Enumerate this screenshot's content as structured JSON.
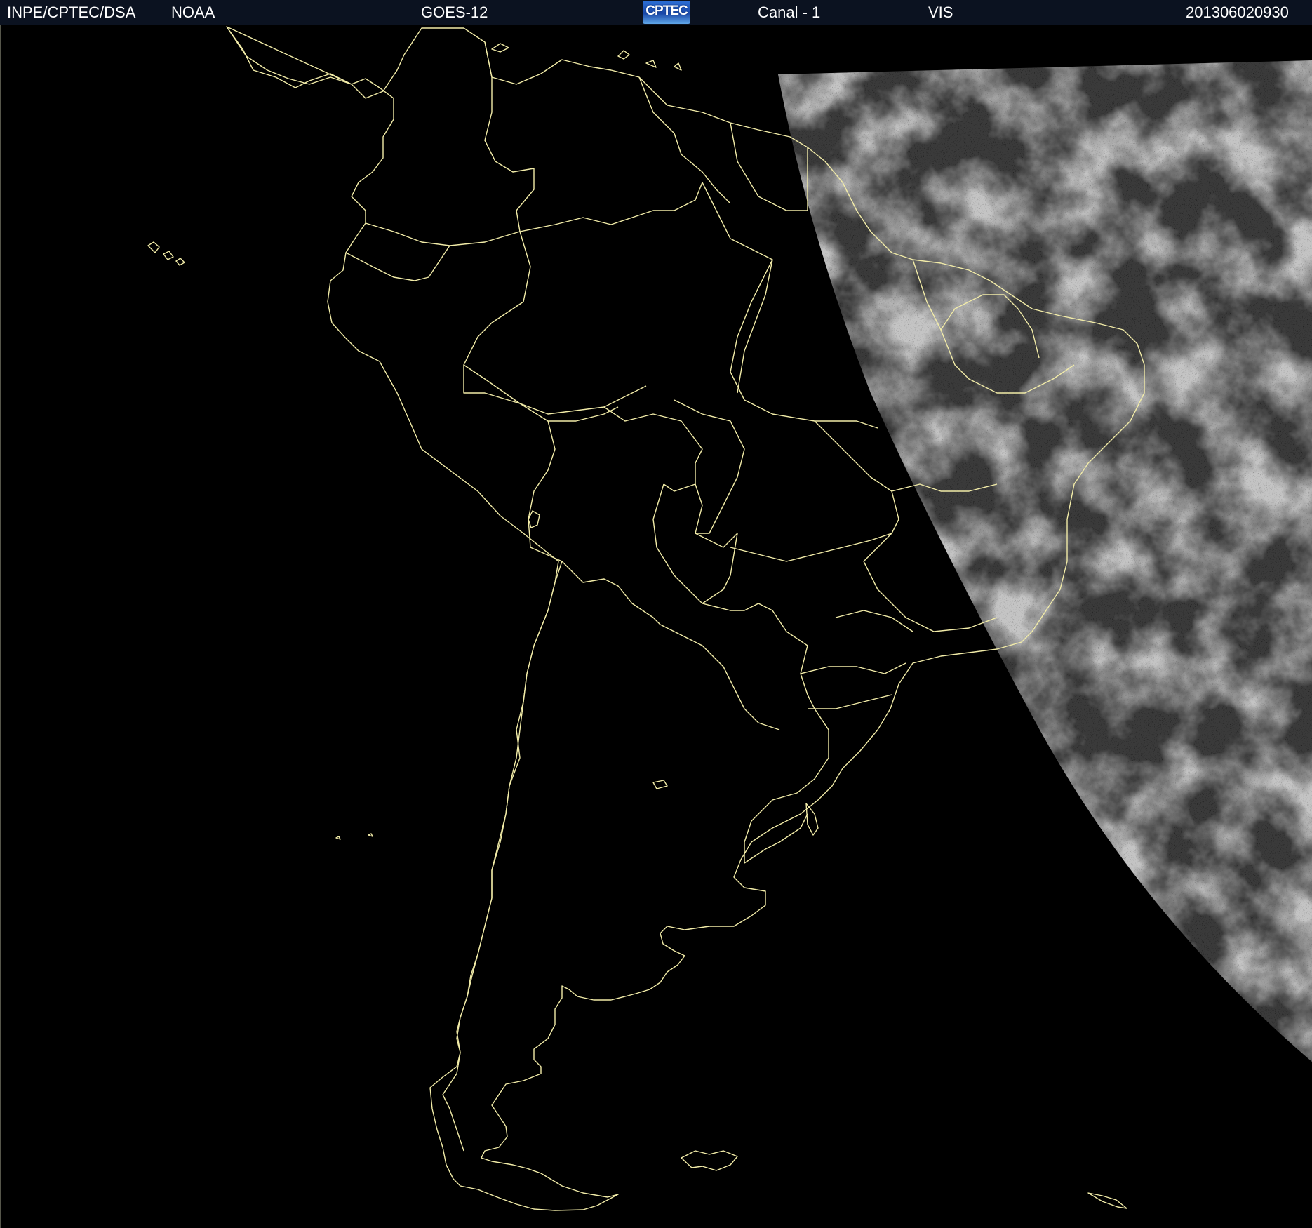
{
  "header": {
    "source": "INPE/CPTEC/DSA",
    "agency": "NOAA",
    "satellite": "GOES-12",
    "logo": "CPTEC",
    "channel": "Canal - 1",
    "band": "VIS",
    "timestamp": "201306020930"
  },
  "map": {
    "region": "South America",
    "background_color": "#000000",
    "boundary_color": "#f2eca8",
    "cloud_color": "#bdbdbd"
  }
}
